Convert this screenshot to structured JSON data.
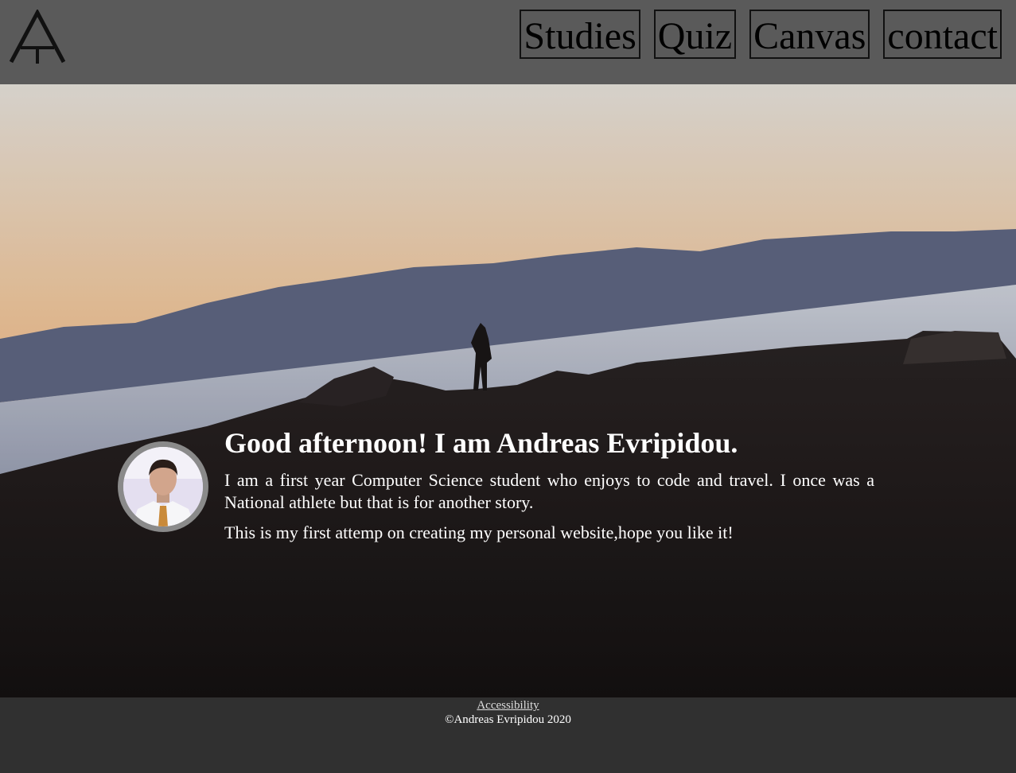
{
  "header": {
    "logo_icon": "andreas-evripidou-monogram-logo",
    "nav": [
      {
        "label": "Studies"
      },
      {
        "label": "Quiz"
      },
      {
        "label": "Canvas"
      },
      {
        "label": "contact"
      }
    ]
  },
  "hero": {
    "background_icon": "sunset-coast-photo",
    "avatar_icon": "profile-photo",
    "greeting": "Good afternoon! I am Andreas Evripidou.",
    "paragraph1": "I am a first year Computer Science student who enjoys to code and travel. I once was a National athlete but that is for another story.",
    "paragraph2": "This is my first attemp on creating my personal website,hope you like it!"
  },
  "footer": {
    "accessibility_link": "Accessibility",
    "copyright": "©Andreas Evripidou 2020"
  },
  "colors": {
    "header_bg": "#5a5a5a",
    "footer_bg": "#303030",
    "text_light": "#ffffff"
  }
}
